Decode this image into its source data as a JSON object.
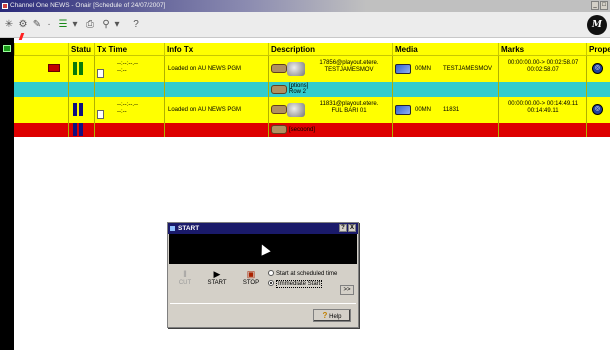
{
  "window": {
    "title": "Channel One NEWS - Onair [Schedule of 24/07/2007]",
    "controls": [
      "_",
      "□"
    ]
  },
  "toolbar": {
    "icons": [
      "star-icon",
      "gear-icon",
      "pencil-icon",
      "add-item-icon",
      "print-icon",
      "zoom-icon"
    ],
    "help_label": "?",
    "logo_letter": "M"
  },
  "columns": [
    "Statu",
    "Tx Time",
    "Info Tx",
    "Description",
    "Media",
    "Marks",
    "Prope"
  ],
  "rows": [
    {
      "tx_time_1": "--:--:--.--",
      "tx_time_2": "--:--",
      "info_tx": "Loaded on AU NEWS PGM",
      "desc_1": "17856@playout.etere.",
      "desc_2": "TESTJAMESMOV",
      "media_id": "00MN",
      "media_name": "TESTJAMESMOV",
      "marks_1": "00:00:00.00-> 00:02:58.07",
      "marks_2": "00:02:58.07",
      "sub_desc_1": "[ptions]",
      "sub_desc_2": "Row 2"
    },
    {
      "tx_time_1": "--:--:--.--",
      "tx_time_2": "--:--",
      "info_tx": "Loaded on AU NEWS PGM",
      "desc_1": "11831@playout.etere.",
      "desc_2": "FUL BARI 01",
      "media_id": "00MN",
      "media_name": "11831",
      "marks_1": "00:00:00.00-> 00:14:49.11",
      "marks_2": "00:14:49.11",
      "sub_desc_1": "[secoond]"
    }
  ],
  "dialog": {
    "title": "START",
    "title_buttons": [
      "?",
      "X"
    ],
    "cut_label": "CUT",
    "start_label": "START",
    "stop_label": "STOP",
    "option_scheduled": "Start at scheduled time",
    "option_immediate": "Immediate Start",
    "more_label": ">>",
    "help_label": "Help"
  },
  "colors": {
    "header_yellow": "#ffff00",
    "row_cyan": "#33cccc",
    "row_red": "#dd0000",
    "title_blue": "#1a1a6a"
  }
}
